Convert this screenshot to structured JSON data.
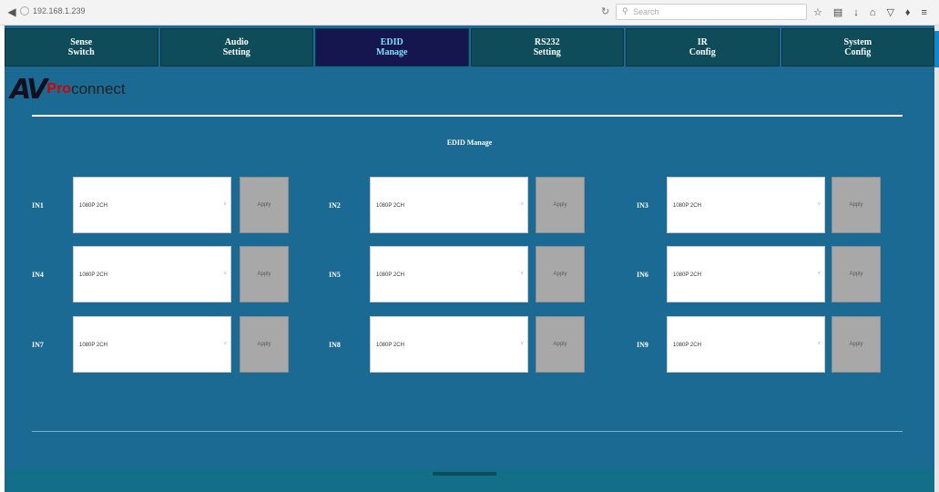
{
  "browser": {
    "url": "192.168.1.239",
    "search_placeholder": "Search",
    "back_icon": "back-arrow-icon",
    "toolbar_icons": [
      "star-icon",
      "clipboard-icon",
      "download-icon",
      "home-icon",
      "pocket-icon",
      "extension-icon",
      "menu-icon"
    ]
  },
  "tabs": [
    {
      "line1": "Sense",
      "line2": "Switch"
    },
    {
      "line1": "Audio",
      "line2": "Setting"
    },
    {
      "line1": "EDID",
      "line2": "Manage"
    },
    {
      "line1": "RS232",
      "line2": "Setting"
    },
    {
      "line1": "IR",
      "line2": "Config"
    },
    {
      "line1": "System",
      "line2": "Config"
    }
  ],
  "active_tab": 2,
  "logo": {
    "av": "AV",
    "pro": "Pro",
    "connect": "connect"
  },
  "section_title": "EDID Manage",
  "inputs": [
    {
      "label": "IN1",
      "value": "1080P 2CH",
      "button": "Apply"
    },
    {
      "label": "IN2",
      "value": "1080P 2CH",
      "button": "Apply"
    },
    {
      "label": "IN3",
      "value": "1080P 2CH",
      "button": "Apply"
    },
    {
      "label": "IN4",
      "value": "1080P 2CH",
      "button": "Apply"
    },
    {
      "label": "IN5",
      "value": "1080P 2CH",
      "button": "Apply"
    },
    {
      "label": "IN6",
      "value": "1080P 2CH",
      "button": "Apply"
    },
    {
      "label": "IN7",
      "value": "1080P 2CH",
      "button": "Apply"
    },
    {
      "label": "IN8",
      "value": "1080P 2CH",
      "button": "Apply"
    },
    {
      "label": "IN9",
      "value": "1080P 2CH",
      "button": "Apply"
    }
  ],
  "colors": {
    "page_bg": "#1a6a93",
    "tab_bg": "#0f4c5a",
    "tab_active_bg": "#15164e",
    "tab_active_text": "#7fe0ff",
    "apply_bg": "#a8a8a8"
  }
}
